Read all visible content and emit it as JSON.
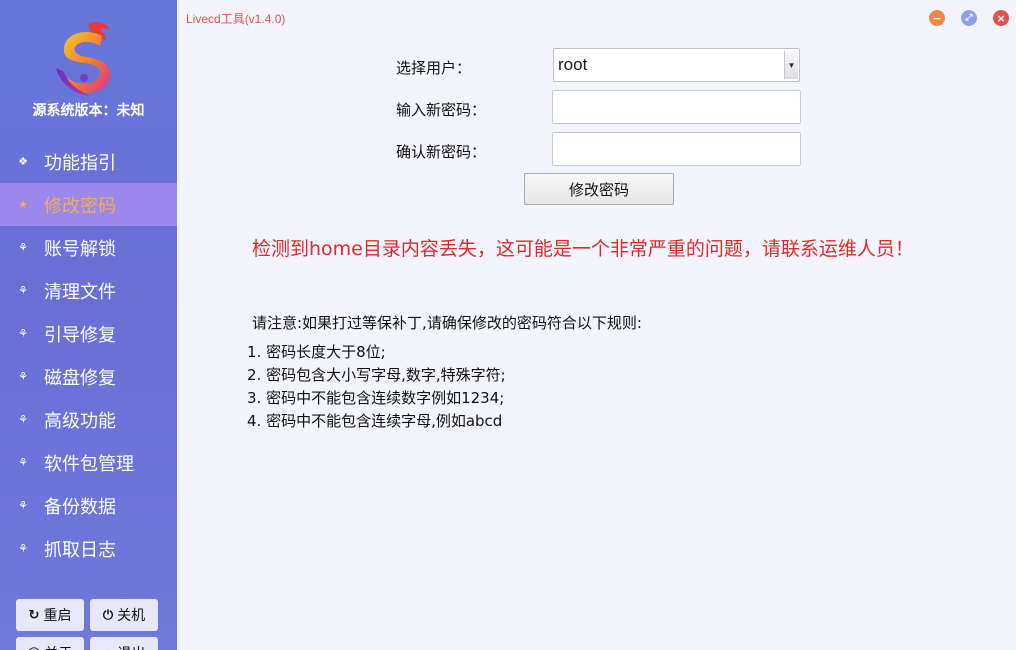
{
  "app": {
    "title": "Livecd工具(v1.4.0)"
  },
  "window_controls": {
    "minimize_color": "#f0864b",
    "maximize_color": "#8fa1ee",
    "close_color": "#e94d4d",
    "icons": [
      "minimize-icon",
      "maximize-icon",
      "close-icon"
    ]
  },
  "sidebar": {
    "source_version": "源系统版本：未知",
    "items": [
      {
        "label": "功能指引",
        "icon": "guide-icon",
        "active": false
      },
      {
        "label": "修改密码",
        "icon": "star-icon",
        "active": true
      },
      {
        "label": "账号解锁",
        "icon": "bug-icon",
        "active": false
      },
      {
        "label": "清理文件",
        "icon": "bug-icon",
        "active": false
      },
      {
        "label": "引导修复",
        "icon": "bug-icon",
        "active": false
      },
      {
        "label": "磁盘修复",
        "icon": "bug-icon",
        "active": false
      },
      {
        "label": "高级功能",
        "icon": "bug-icon",
        "active": false
      },
      {
        "label": "软件包管理",
        "icon": "bug-icon",
        "active": false
      },
      {
        "label": "备份数据",
        "icon": "bug-icon",
        "active": false
      },
      {
        "label": "抓取日志",
        "icon": "bug-icon",
        "active": false
      }
    ],
    "buttons": [
      {
        "label": "重启",
        "icon": "restart-icon"
      },
      {
        "label": "关机",
        "icon": "power-icon"
      },
      {
        "label": "关于",
        "icon": "about-icon"
      },
      {
        "label": "退出",
        "icon": "exit-icon"
      }
    ],
    "active_color": "#f2ad54"
  },
  "form": {
    "select_user_label": "选择用户：",
    "select_user_value": "root",
    "new_password_label": "输入新密码：",
    "new_password_value": "",
    "confirm_password_label": "确认新密码：",
    "confirm_password_value": "",
    "submit_label": "修改密码"
  },
  "warning": {
    "text": "检测到home目录内容丢失，这可能是一个非常严重的问题，请联系运维人员！",
    "color": "#e02a2a"
  },
  "notice": {
    "title": "请注意:如果打过等保补丁,请确保修改的密码符合以下规则:",
    "rules": [
      "1. 密码长度大于8位;",
      "2. 密码包含大小写字母,数字,特殊字符;",
      "3. 密码中不能包含连续数字例如1234;",
      "4. 密码中不能包含连续字母,例如abcd"
    ]
  }
}
